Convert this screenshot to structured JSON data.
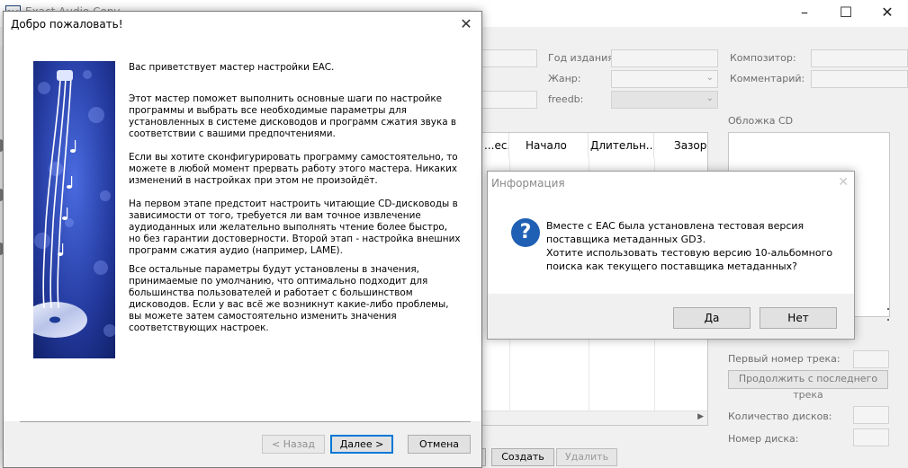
{
  "main_window": {
    "title": "Exact Audio Copy",
    "menu_char": "E",
    "fields": {
      "year_label": "Год издания:",
      "genre_label": "Жанр:",
      "freedb_label": "freedb:",
      "composer_label": "Композитор:",
      "comment_label": "Комментарий:"
    },
    "track_columns": [
      "...ес...",
      "Начало",
      "Длительн...",
      "Зазор"
    ],
    "cover_label": "Обложка CD",
    "first_track_label": "Первый номер трека:",
    "continue_button": "Продолжить с последнего трека",
    "disc_count_label": "Количество дисков:",
    "disc_number_label": "Номер диска:",
    "create_button": "Создать",
    "delete_button": "Удалить",
    "bottom_char": "B"
  },
  "wizard": {
    "title": "Добро пожаловать!",
    "paragraphs": [
      "Вас приветствует мастер настройки EAC.",
      "Этот мастер поможет выполнить основные шаги по настройке программы и выбрать все необходимые параметры для установленных в системе дисководов и программ сжатия звука в соответствии с вашими предпочтениями.",
      "Если вы хотите сконфигурировать программу самостоятельно, то можете в любой момент прервать работу этого мастера. Никаких изменений в настройках при этом не произойдёт.",
      "На первом этапе предстоит настроить читающие CD-дисководы в зависимости от того, требуется ли вам точное извлечение аудиоданных или желательно выполнять чтение более быстро, но без гарантии достоверности. Второй этап - настройка внешних программ сжатия аудио (например, LAME).",
      "Все остальные параметры будут установлены в значения, принимаемые по умолчанию, что оптимально подходит для большинства пользователей и работает с большинством дисководов. Если у вас всё же возникнут какие-либо проблемы, вы можете затем самостоятельно изменить значения соответствующих настроек."
    ],
    "back_button": "< Назад",
    "next_button": "Далее >",
    "cancel_button": "Отмена"
  },
  "info_dialog": {
    "title": "Информация",
    "icon": "question-icon",
    "message_lines": [
      "Вместе с EAC была установлена тестовая версия",
      "поставщика метаданных GD3.",
      "Хотите использовать тестовую версию 10-альбомного",
      "поиска как текущего поставщика метаданных?"
    ],
    "yes_button": "Да",
    "no_button": "Нет"
  },
  "colors": {
    "accent": "#0078d7",
    "question_icon": "#1f5fb4",
    "wizard_image": "#1c3a96"
  }
}
